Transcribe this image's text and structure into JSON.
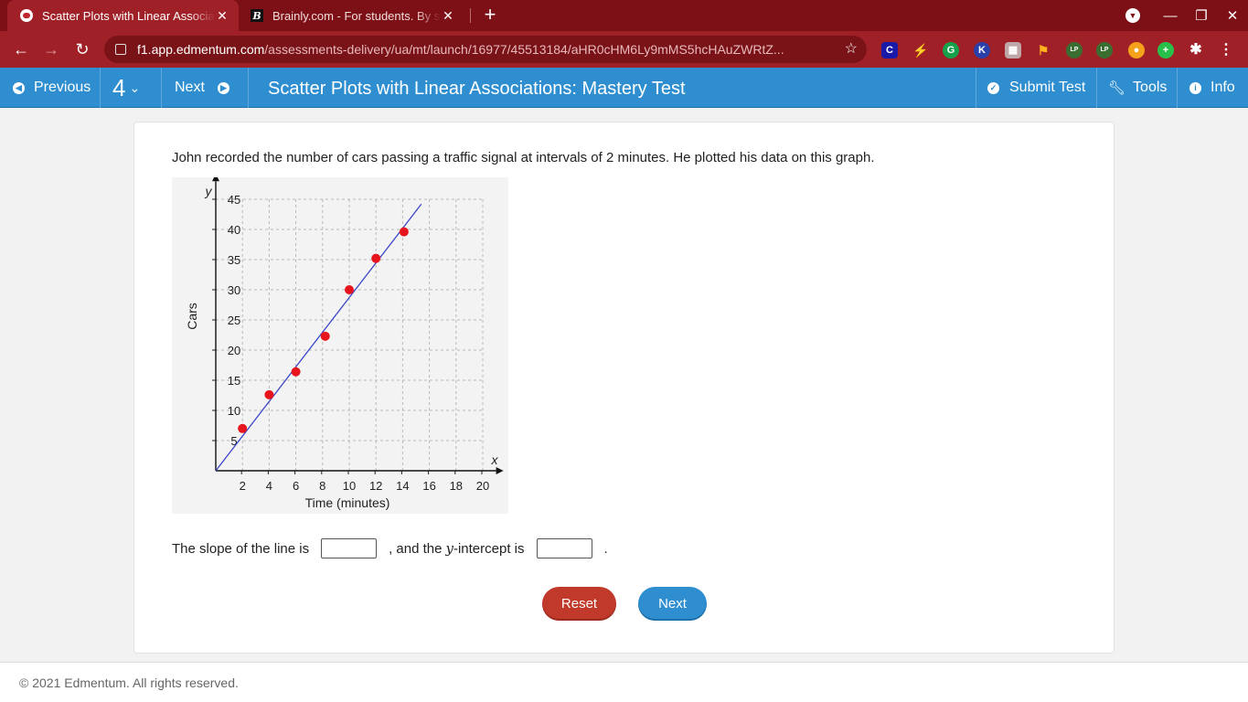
{
  "browser": {
    "tabs": [
      {
        "title": "Scatter Plots with Linear Associa",
        "icon": "edmentum-icon"
      },
      {
        "title": "Brainly.com - For students. By st",
        "icon": "brainly-icon"
      }
    ],
    "url_host": "f1.app.edmentum.com",
    "url_path": "/assessments-delivery/ua/mt/launch/16977/45513184/aHR0cHM6Ly9mMS5hcHAuZWRtZ...",
    "extensions": [
      {
        "name": "c-extension-icon",
        "label": "C",
        "color": "#1a1aa8"
      },
      {
        "name": "k-extension-icon",
        "label": "K",
        "color": "#2b3fa8"
      },
      {
        "name": "lp-extension-icon",
        "label": "LP",
        "color": "#3a6d30"
      }
    ]
  },
  "appbar": {
    "previous_label": "Previous",
    "question_number": "4",
    "next_label": "Next",
    "test_title": "Scatter Plots with Linear Associations: Mastery Test",
    "submit_label": "Submit Test",
    "tools_label": "Tools",
    "info_label": "Info"
  },
  "question": {
    "text": "John recorded the number of cars passing a traffic signal at intervals of 2 minutes. He plotted his data on this graph.",
    "answer_prefix": "The slope of the line is",
    "answer_middle_1": ", and the",
    "answer_middle_var": "y",
    "answer_middle_2": "-intercept is",
    "answer_suffix": ".",
    "slope_value": "",
    "intercept_value": ""
  },
  "buttons": {
    "reset_label": "Reset",
    "next_label": "Next"
  },
  "footer": {
    "copyright": "© 2021 Edmentum. All rights reserved."
  },
  "chart_data": {
    "type": "scatter",
    "title": "",
    "xlabel": "Time (minutes)",
    "ylabel": "Cars",
    "x_axis_var": "x",
    "y_axis_var": "y",
    "xlim": [
      0,
      21
    ],
    "ylim": [
      0,
      48
    ],
    "x_ticks": [
      2,
      4,
      6,
      8,
      10,
      12,
      14,
      16,
      18,
      20
    ],
    "y_ticks": [
      5,
      10,
      15,
      20,
      25,
      30,
      35,
      40,
      45
    ],
    "grid": true,
    "points": [
      {
        "x": 2,
        "y": 7
      },
      {
        "x": 4,
        "y": 12.6
      },
      {
        "x": 6,
        "y": 16.4
      },
      {
        "x": 8.2,
        "y": 22.3
      },
      {
        "x": 10,
        "y": 30
      },
      {
        "x": 12,
        "y": 35.2
      },
      {
        "x": 14.1,
        "y": 39.6
      }
    ],
    "line": {
      "x1": 0,
      "y1": 0,
      "x2": 15.4,
      "y2": 44.2
    },
    "point_color": "#e8141c",
    "line_color": "#3c46c8"
  }
}
